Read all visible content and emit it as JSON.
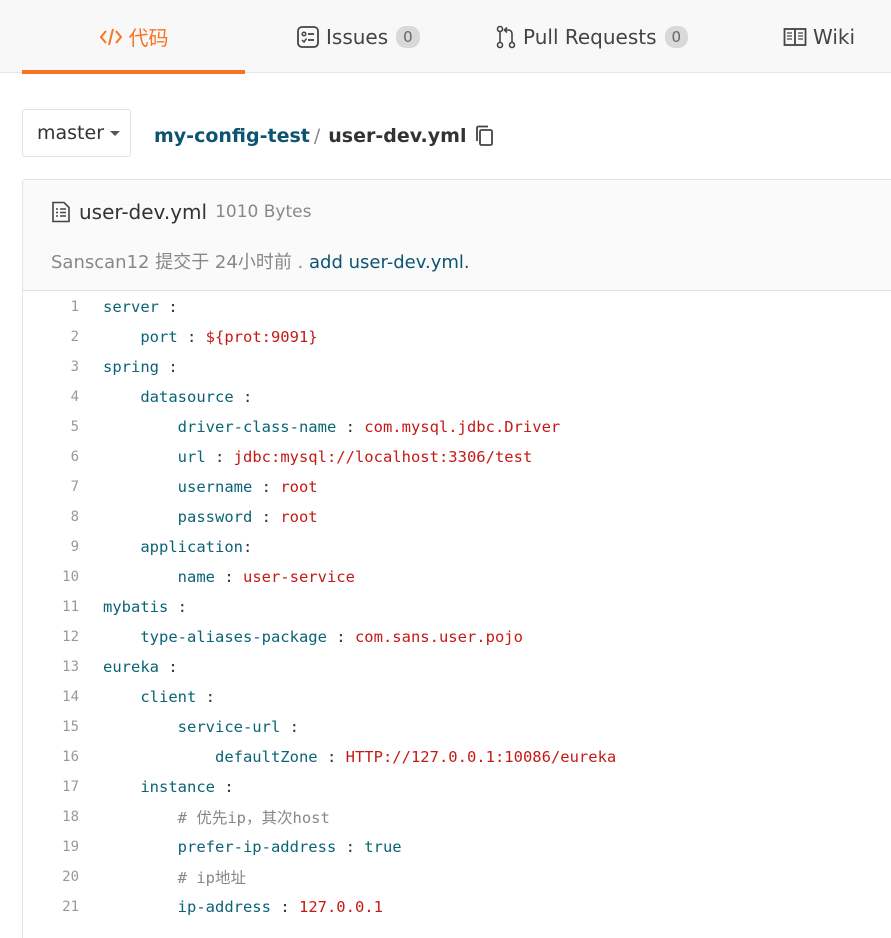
{
  "tabs": {
    "code": {
      "label": "代码",
      "icon": "code-icon"
    },
    "issues": {
      "label": "Issues",
      "count": "0",
      "icon": "issues-icon"
    },
    "pull_requests": {
      "label": "Pull Requests",
      "count": "0",
      "icon": "pull-request-icon"
    },
    "wiki": {
      "label": "Wiki",
      "icon": "book-icon"
    }
  },
  "branch": {
    "label": "master"
  },
  "breadcrumb": {
    "repo": "my-config-test",
    "separator": "/",
    "file": "user-dev.yml"
  },
  "file": {
    "name": "user-dev.yml",
    "size": "1010 Bytes",
    "commit_author_time": "Sanscan12 提交于 24小时前 .",
    "commit_message": "add user-dev.yml."
  },
  "colors": {
    "accent": "#f77423",
    "link": "#0d5373",
    "key": "#0b6476",
    "value": "#c41a16"
  },
  "code_lines": [
    {
      "n": "1",
      "indent": "",
      "key": "server",
      "sep": " :",
      "value": ""
    },
    {
      "n": "2",
      "indent": "    ",
      "key": "port",
      "sep": " : ",
      "value": "${prot:9091}"
    },
    {
      "n": "3",
      "indent": "",
      "key": "spring",
      "sep": " :",
      "value": ""
    },
    {
      "n": "4",
      "indent": "    ",
      "key": "datasource",
      "sep": " :",
      "value": ""
    },
    {
      "n": "5",
      "indent": "        ",
      "key": "driver-class-name",
      "sep": " : ",
      "value": "com.mysql.jdbc.Driver"
    },
    {
      "n": "6",
      "indent": "        ",
      "key": "url",
      "sep": " : ",
      "value": "jdbc:mysql://localhost:3306/test"
    },
    {
      "n": "7",
      "indent": "        ",
      "key": "username",
      "sep": " : ",
      "value": "root"
    },
    {
      "n": "8",
      "indent": "        ",
      "key": "password",
      "sep": " : ",
      "value": "root"
    },
    {
      "n": "9",
      "indent": "    ",
      "key": "application",
      "sep": ":",
      "value": ""
    },
    {
      "n": "10",
      "indent": "        ",
      "key": "name",
      "sep": " : ",
      "value": "user-service"
    },
    {
      "n": "11",
      "indent": "",
      "key": "mybatis",
      "sep": " :",
      "value": ""
    },
    {
      "n": "12",
      "indent": "    ",
      "key": "type-aliases-package",
      "sep": " : ",
      "value": "com.sans.user.pojo"
    },
    {
      "n": "13",
      "indent": "",
      "key": "eureka",
      "sep": " :",
      "value": ""
    },
    {
      "n": "14",
      "indent": "    ",
      "key": "client",
      "sep": " :",
      "value": ""
    },
    {
      "n": "15",
      "indent": "        ",
      "key": "service-url",
      "sep": " :",
      "value": ""
    },
    {
      "n": "16",
      "indent": "            ",
      "key": "defaultZone",
      "sep": " : ",
      "value": "HTTP://127.0.0.1:10086/eureka"
    },
    {
      "n": "17",
      "indent": "    ",
      "key": "instance",
      "sep": " :",
      "value": ""
    },
    {
      "n": "18",
      "indent": "        ",
      "comment": "# 优先ip，其次host"
    },
    {
      "n": "19",
      "indent": "        ",
      "key": "prefer-ip-address",
      "sep": " : ",
      "value": "true",
      "value_class": "k"
    },
    {
      "n": "20",
      "indent": "        ",
      "comment": "# ip地址"
    },
    {
      "n": "21",
      "indent": "        ",
      "key": "ip-address",
      "sep": " : ",
      "value": "127.0.0.1"
    }
  ]
}
